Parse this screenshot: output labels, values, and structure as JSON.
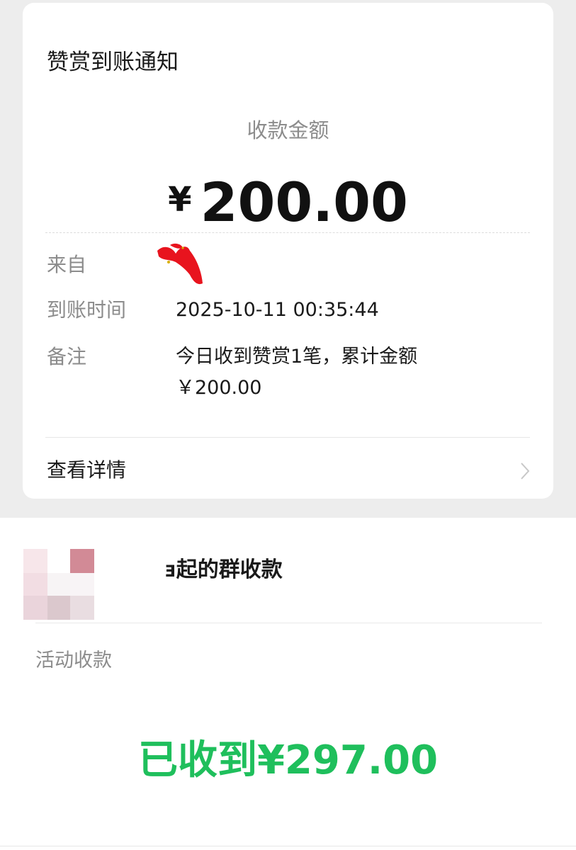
{
  "notification": {
    "title": "赞赏到账通知",
    "amount_label": "收款金额",
    "currency_symbol": "¥",
    "amount": "200.00",
    "rows": [
      {
        "label": "来自",
        "value": ""
      },
      {
        "label": "到账时间",
        "value": "2025-10-11 00:35:44"
      },
      {
        "label": "备注",
        "value_line1": "今日收到赞赏1笔，累计金额",
        "value_line2": "￥200.00"
      }
    ],
    "details_label": "查看详情",
    "sender_redaction_color": "#e8141e"
  },
  "group_payment": {
    "title": "ⱻ起的群收款",
    "activity_label": "活动收款",
    "received_text": "已收到¥297.00",
    "received_color": "#1fbf5c"
  }
}
